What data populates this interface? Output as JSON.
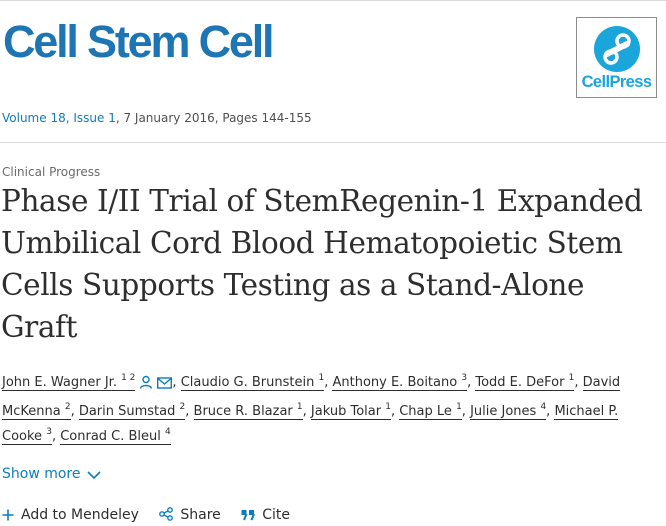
{
  "journal": {
    "title": "Cell Stem Cell",
    "publisher_logo_text": "CellPress"
  },
  "issue": {
    "volume_issue": "Volume 18, Issue 1",
    "date_pages": ", 7 January 2016, Pages 144-155"
  },
  "article": {
    "type": "Clinical Progress",
    "title": "Phase I/II Trial of StemRegenin-1 Expanded Umbilical Cord Blood Hematopoietic Stem Cells Supports Testing as a Stand-Alone Graft"
  },
  "authors": [
    {
      "name": "John E. Wagner Jr.",
      "sup": "1 2"
    },
    {
      "name": "Claudio G. Brunstein",
      "sup": "1"
    },
    {
      "name": "Anthony E. Boitano",
      "sup": "3"
    },
    {
      "name": "Todd E. DeFor",
      "sup": "1"
    },
    {
      "name": "David McKenna",
      "sup": "2"
    },
    {
      "name": "Darin Sumstad",
      "sup": "2"
    },
    {
      "name": "Bruce R. Blazar",
      "sup": "1"
    },
    {
      "name": "Jakub Tolar",
      "sup": "1"
    },
    {
      "name": "Chap Le",
      "sup": "1"
    },
    {
      "name": "Julie Jones",
      "sup": "4"
    },
    {
      "name": "Michael P. Cooke",
      "sup": "3"
    },
    {
      "name": "Conrad C. Bleul",
      "sup": "4"
    }
  ],
  "separator": ", ",
  "show_more": "Show more",
  "actions": {
    "mendeley": "Add to Mendeley",
    "share": "Share",
    "cite": "Cite"
  },
  "colors": {
    "brand": "#1d75b3",
    "link": "#0c7dbb",
    "cellpress": "#1aa5db"
  },
  "icons": [
    "person-icon",
    "envelope-icon",
    "chevron-down-icon",
    "plus-icon",
    "share-icon",
    "quote-icon"
  ]
}
